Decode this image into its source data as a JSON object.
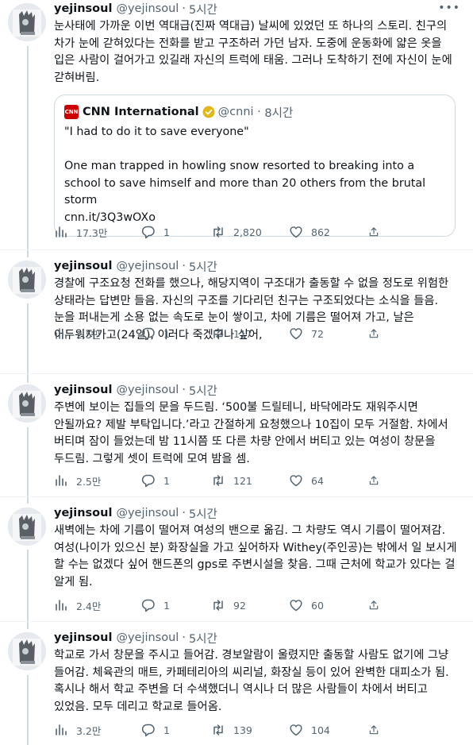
{
  "tweets": [
    {
      "name": "yejinsoul",
      "handle": "@yejinsoul",
      "time": "5시간",
      "text": "눈사태에 가까운 이번 역대급(진짜 역대급) 날씨에 있었던 또 하나의 스토리. 친구의 차가 눈에 갇혀있다는 전화를 받고 구조하러 가던 남자. 도중에 운동화에 얇은 옷을 입은 사람이 걸어가고 있길래 자신의 트럭에 태움. 그러나 도착하기 전에 자신이 눈에 갇혀버림.",
      "quote": {
        "name": "CNN International",
        "handle": "@cnni",
        "time": "8시간",
        "logo_text": "CNN",
        "line1": "\"I had to do it to save everyone\"",
        "line2": "One man trapped in howling snow resorted to breaking into a school to save himself and more than 20 others from the brutal storm",
        "link": "cnn.it/3Q3wOXo"
      },
      "views": "17.3만",
      "replies": "1",
      "retweets": "2,820",
      "likes": "862"
    },
    {
      "name": "yejinsoul",
      "handle": "@yejinsoul",
      "time": "5시간",
      "text": "경찰에 구조요청 전화를 했으나, 해당지역이 구조대가 출동할 수 없을 정도로 위험한 상태라는 답변만 들음. 자신의 구조를 기다리던 친구는 구조되었다는 소식을 들음. 눈을 퍼내는게 소용 없는 속도로 눈이 쌓이고, 차에 기름은 떨어져 가고, 날은 어두워져가고(24일), 이러다 죽겠구나 싶어,",
      "views": "2.5만",
      "replies": "1",
      "retweets": "117",
      "likes": "72"
    },
    {
      "name": "yejinsoul",
      "handle": "@yejinsoul",
      "time": "5시간",
      "text": "주변에 보이는 집들의 문을 두드림. ‘500불 드릴테니, 바닥에라도 재워주시면 안될까요? 제발 부탁입니다.’라고 간절하게 요청했으나 10집이 모두 거절함. 차에서 버티며 잠이 들었는데 밤 11시쯤 또 다른 차량 안에서 버티고 있는 여성이 창문을 두드림. 그렇게 셋이 트럭에 모여 밤을 셈.",
      "views": "2.5만",
      "replies": "1",
      "retweets": "121",
      "likes": "64"
    },
    {
      "name": "yejinsoul",
      "handle": "@yejinsoul",
      "time": "5시간",
      "text": "새벽에는 차에 기름이 떨어져 여성의 밴으로 옮김. 그 차량도 역시 기름이 떨어져감. 여성(나이가 있으신 분) 화장실을 가고 싶어하자 Withey(주인공)는 밖에서 일 보시게 할 수는 없겠다 싶어 핸드폰의 gps로 주변시설을 찾음. 그때 근처에 학교가 있다는 걸 알게 됨.",
      "views": "2.4만",
      "replies": "1",
      "retweets": "92",
      "likes": "60"
    },
    {
      "name": "yejinsoul",
      "handle": "@yejinsoul",
      "time": "5시간",
      "text": "학교로 가서 창문을 주시고 들어감. 경보알람이 울렸지만 출동할 사람도 없기에 그냥 들어감. 체육관의 매트, 카페테리아의 씨리널, 화장실 등이 있어 완벽한 대피소가 됨. 혹시나 해서 학교 주변을 더 수색했더니 역시나 더 많은 사람들이 차에서 버티고 있었음. 모두 데리고 학교로 들어옴.",
      "views": "3.2만",
      "replies": "1",
      "retweets": "139",
      "likes": "104"
    }
  ],
  "colors": {
    "text": "#0f1419",
    "secondary": "#536471",
    "border": "#cfd9de",
    "cnn_red": "#cc0000",
    "verified_gold": "#e2b719"
  }
}
